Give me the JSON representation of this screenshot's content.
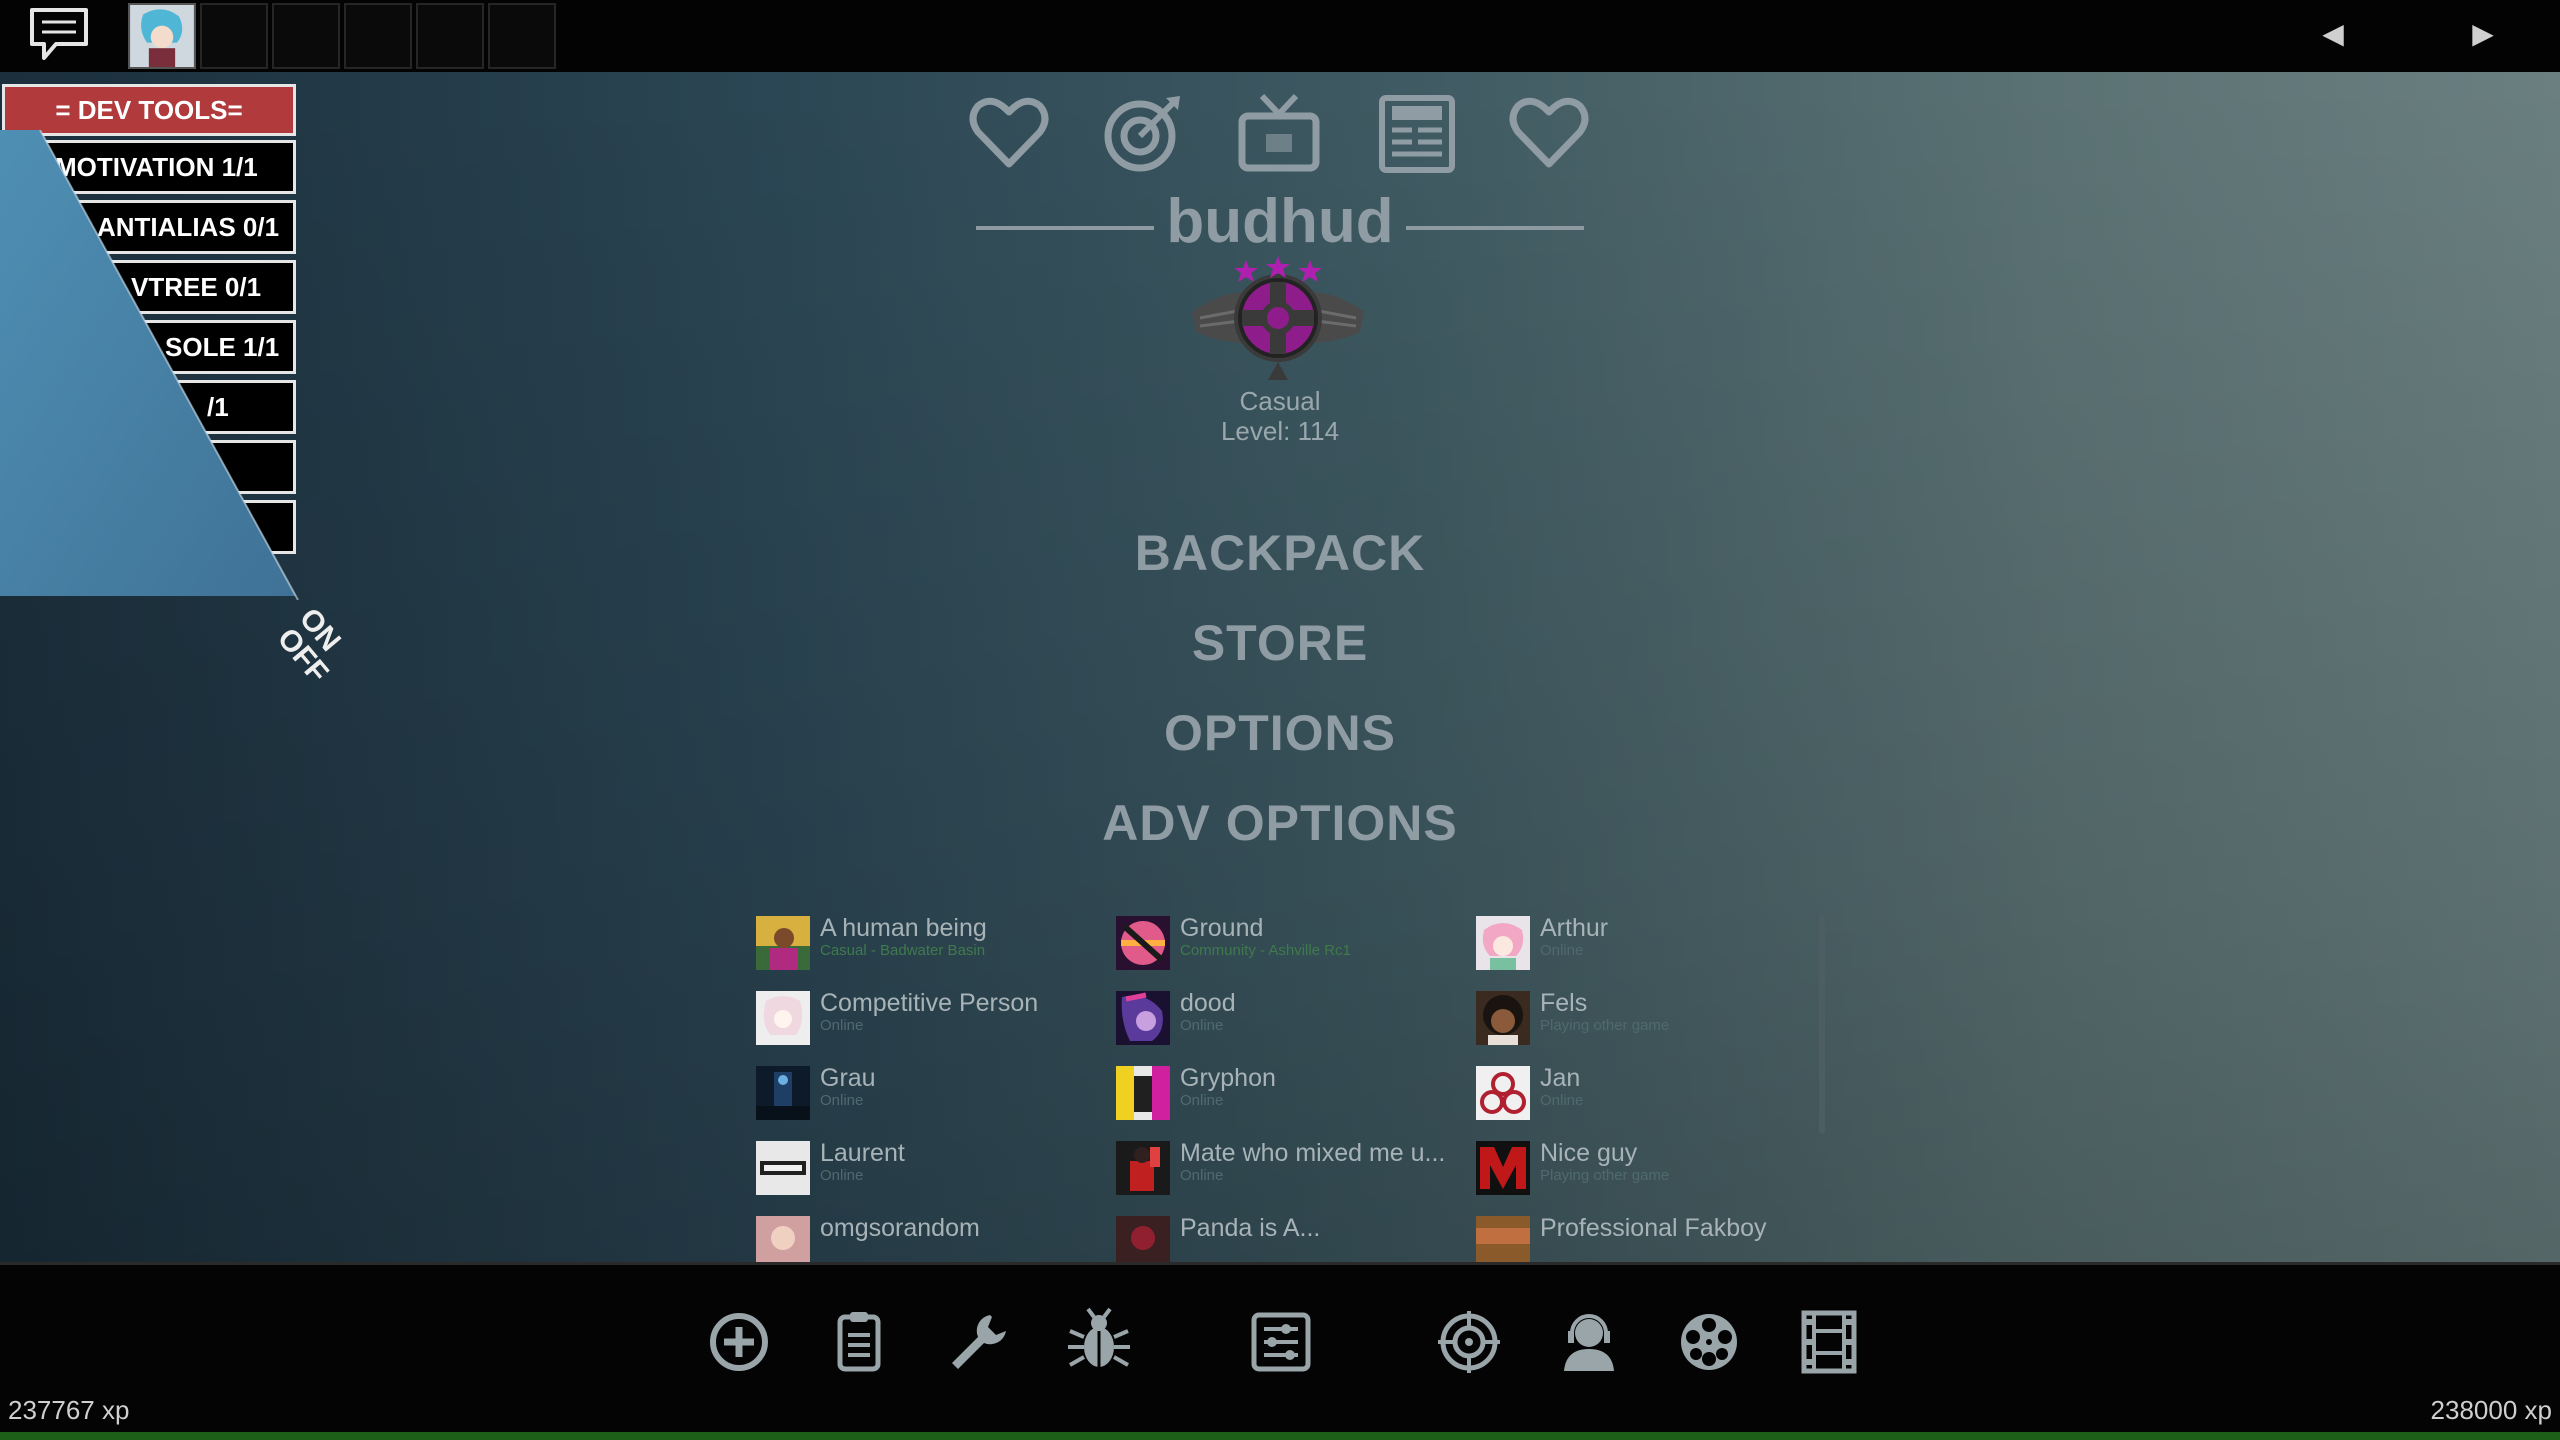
{
  "topbar": {
    "chat_icon": "chat-bubble-icon",
    "party_slots": 6,
    "arrow_left": "◀",
    "arrow_right": "▶"
  },
  "header_icons": [
    "heart-icon",
    "target-icon",
    "tv-icon",
    "news-icon",
    "heart-icon"
  ],
  "profile": {
    "username": "budhud",
    "rank_name": "Casual",
    "rank_level": "Level: 114"
  },
  "menu": {
    "backpack": "BACKPACK",
    "store": "STORE",
    "options": "OPTIONS",
    "adv_options": "ADV OPTIONS"
  },
  "dev_tools": {
    "title": "= DEV TOOLS=",
    "rows": [
      "MOTIVATION 1/1",
      "ANTIALIAS 0/1",
      "VTREE 0/1",
      "SOLE 1/1",
      "/1",
      "",
      ""
    ],
    "on_label": "ON",
    "off_label": "OFF"
  },
  "friends": [
    {
      "name": "A human being",
      "status": "Casual - Badwater Basin",
      "in_game": true
    },
    {
      "name": "Ground",
      "status": "Community - Ashville Rc1",
      "in_game": true
    },
    {
      "name": "Arthur",
      "status": "Online",
      "in_game": false
    },
    {
      "name": "Competitive Person",
      "status": "Online",
      "in_game": false
    },
    {
      "name": "dood",
      "status": "Online",
      "in_game": false
    },
    {
      "name": "Fels",
      "status": "Playing other game",
      "in_game": false
    },
    {
      "name": "Grau",
      "status": "Online",
      "in_game": false
    },
    {
      "name": "Gryphon",
      "status": "Online",
      "in_game": false
    },
    {
      "name": "Jan",
      "status": "Online",
      "in_game": false
    },
    {
      "name": "Laurent",
      "status": "Online",
      "in_game": false
    },
    {
      "name": "Mate who mixed me u...",
      "status": "Online",
      "in_game": false
    },
    {
      "name": "Nice guy",
      "status": "Playing other game",
      "in_game": false
    },
    {
      "name": "omgsorandom",
      "status": "",
      "in_game": false
    },
    {
      "name": "Panda is A...",
      "status": "",
      "in_game": false
    },
    {
      "name": "Professional Fakboy",
      "status": "",
      "in_game": false
    }
  ],
  "bottom_icons": [
    "plus-circle-icon",
    "clipboard-icon",
    "wrench-icon",
    "bug-icon",
    "settings-list-icon",
    "crosshair-icon",
    "user-support-icon",
    "film-reel-icon",
    "film-strip-icon"
  ],
  "xp": {
    "current": "237767 xp",
    "next": "238000 xp",
    "progress": 0.0
  },
  "colors": {
    "dev_title_bg": "#b13a3c",
    "rank_emblem": "#8e1c8a",
    "menu_text": "#8f9ca3"
  }
}
